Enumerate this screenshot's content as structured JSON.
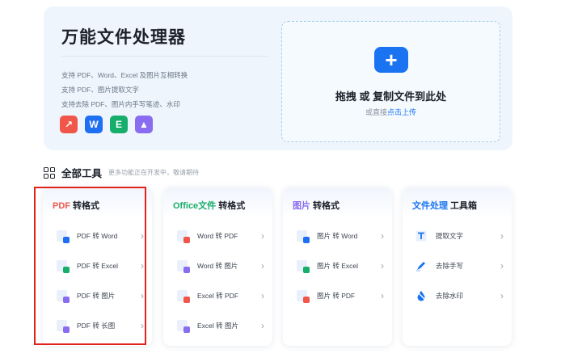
{
  "hero": {
    "title": "万能文件处理器",
    "features": [
      "支持 PDF、Word、Excel 及图片互相转换",
      "支持 PDF、图片提取文字",
      "支持去除 PDF、图片内手写笔迹、水印"
    ],
    "format_icons": [
      {
        "name": "pdf-format-icon",
        "glyph": "↗",
        "color": "#f0574a"
      },
      {
        "name": "word-format-icon",
        "glyph": "W",
        "color": "#1f6ff2"
      },
      {
        "name": "excel-format-icon",
        "glyph": "E",
        "color": "#17ad6a"
      },
      {
        "name": "image-format-icon",
        "glyph": "▲",
        "color": "#8a6cf0"
      }
    ]
  },
  "upload": {
    "plus_glyph": "+",
    "title": "拖拽 或 复制文件到此处",
    "sub_prefix": "或直接",
    "sub_link": "点击上传"
  },
  "all_tools": {
    "label": "全部工具",
    "note": "更多功能正在开发中，敬请期待"
  },
  "chevron": "›",
  "cards": [
    {
      "highlight": "PDF",
      "highlight_color": "#f0574a",
      "suffix": " 转格式",
      "items": [
        "PDF 转 Word",
        "PDF 转 Excel",
        "PDF 转 图片",
        "PDF 转 长图"
      ]
    },
    {
      "highlight": "Office文件",
      "highlight_color": "#17ad6a",
      "suffix": " 转格式",
      "items": [
        "Word 转 PDF",
        "Word 转 图片",
        "Excel 转 PDF",
        "Excel 转 图片"
      ]
    },
    {
      "highlight": "图片",
      "highlight_color": "#8a6cf0",
      "suffix": " 转格式",
      "items": [
        "图片 转 Word",
        "图片 转 Excel",
        "图片 转 PDF"
      ]
    },
    {
      "highlight": "文件处理",
      "highlight_color": "#1a73f0",
      "suffix": " 工具箱",
      "items": [
        "提取文字",
        "去除手写",
        "去除水印"
      ]
    }
  ],
  "colors": {
    "accent": "#1a73f0",
    "selection_outline": "#e2231a",
    "hero_background": "#eef5fd"
  }
}
